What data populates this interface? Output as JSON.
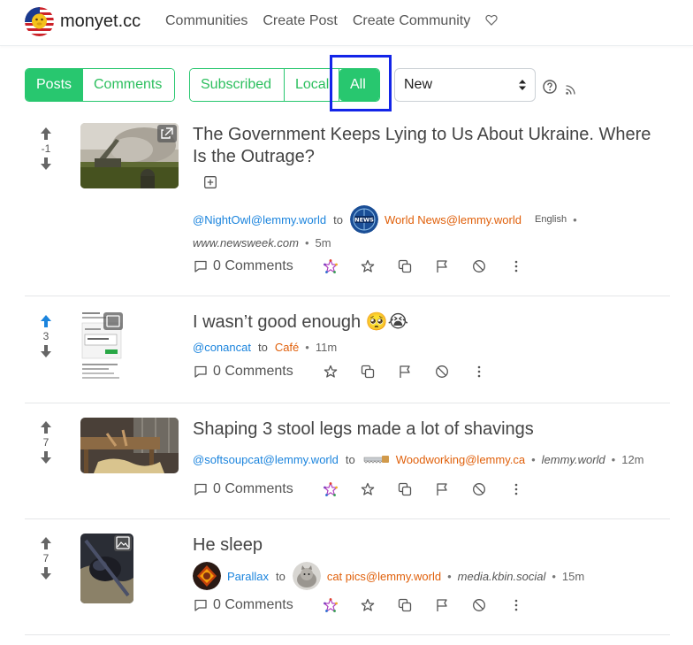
{
  "brand": {
    "name": "monyet.cc"
  },
  "nav": {
    "communities": "Communities",
    "create_post": "Create Post",
    "create_community": "Create Community"
  },
  "filters": {
    "view": {
      "posts": "Posts",
      "comments": "Comments",
      "active": "Posts"
    },
    "listing": {
      "subscribed": "Subscribed",
      "local": "Local",
      "all": "All",
      "active": "All"
    },
    "sort": {
      "selected": "New"
    }
  },
  "colors": {
    "accent_green": "#28c76f",
    "link_blue": "#1b84dd",
    "community_orange": "#e0600b",
    "highlight_box": "#1325e8",
    "upvoted_blue": "#1b84dd"
  },
  "posts": [
    {
      "title": "The Government Keeps Lying to Us About Ukraine. Where Is the Outrage?",
      "score": "-1",
      "user": "@NightOwl@lemmy.world",
      "to": "to",
      "community": "World News@lemmy.world",
      "language": "English",
      "domain": "www.newsweek.com",
      "age": "5m",
      "comments": "0 Comments",
      "upvoted": false
    },
    {
      "title": "I wasn’t good enough 🥺😭",
      "score": "3",
      "user": "@conancat",
      "to": "to",
      "community": "Café",
      "age": "11m",
      "comments": "0 Comments",
      "upvoted": true
    },
    {
      "title": "Shaping 3 stool legs made a lot of shavings",
      "score": "7",
      "user": "@softsoupcat@lemmy.world",
      "to": "to",
      "community": "Woodworking@lemmy.ca",
      "domain": "lemmy.world",
      "age": "12m",
      "comments": "0 Comments",
      "upvoted": false
    },
    {
      "title": "He sleep",
      "score": "7",
      "user": "Parallax",
      "to": "to",
      "community": "cat pics@lemmy.world",
      "domain": "media.kbin.social",
      "age": "15m",
      "comments": "0 Comments",
      "upvoted": false
    }
  ]
}
